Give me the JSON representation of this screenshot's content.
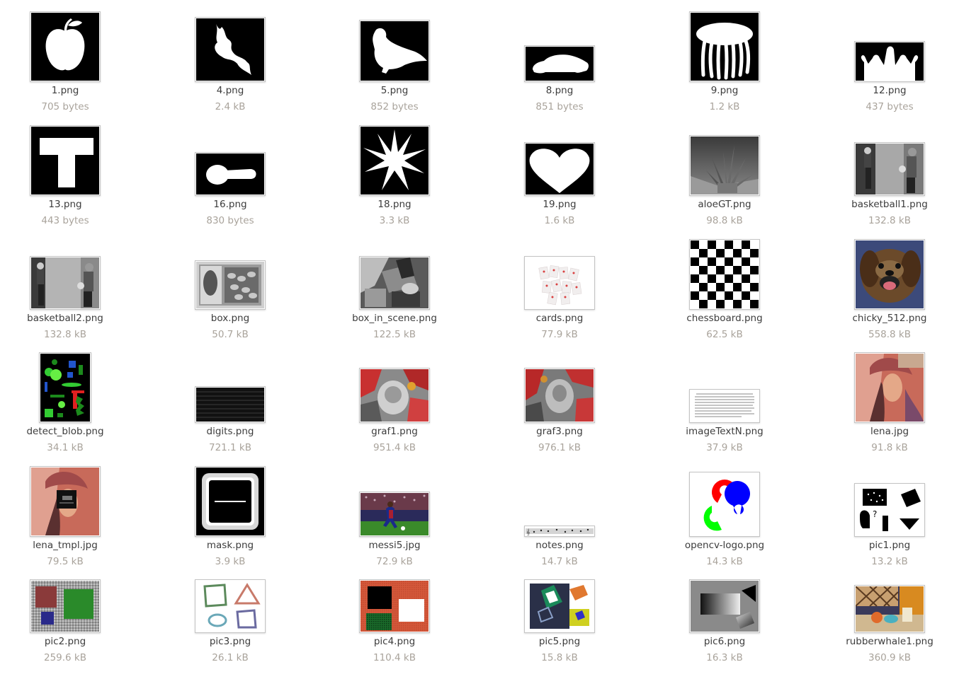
{
  "files": [
    {
      "name": "1.png",
      "size": "705 bytes",
      "icon": "apple-silhouette"
    },
    {
      "name": "4.png",
      "size": "2.4 kB",
      "icon": "bat-silhouette"
    },
    {
      "name": "5.png",
      "size": "852 bytes",
      "icon": "bird-silhouette"
    },
    {
      "name": "8.png",
      "size": "851 bytes",
      "icon": "car-silhouette"
    },
    {
      "name": "9.png",
      "size": "1.2 kB",
      "icon": "jellyfish-silhouette"
    },
    {
      "name": "12.png",
      "size": "437 bytes",
      "icon": "crown-silhouette"
    },
    {
      "name": "13.png",
      "size": "443 bytes",
      "icon": "t-shape"
    },
    {
      "name": "16.png",
      "size": "830 bytes",
      "icon": "key-silhouette"
    },
    {
      "name": "18.png",
      "size": "3.3 kB",
      "icon": "star-burst"
    },
    {
      "name": "19.png",
      "size": "1.6 kB",
      "icon": "heart-silhouette"
    },
    {
      "name": "aloeGT.png",
      "size": "98.8 kB",
      "icon": "aloe-depth"
    },
    {
      "name": "basketball1.png",
      "size": "132.8 kB",
      "icon": "basketball-photo"
    },
    {
      "name": "basketball2.png",
      "size": "132.8 kB",
      "icon": "basketball-photo"
    },
    {
      "name": "box.png",
      "size": "50.7 kB",
      "icon": "box-photo"
    },
    {
      "name": "box_in_scene.png",
      "size": "122.5 kB",
      "icon": "scene-photo"
    },
    {
      "name": "cards.png",
      "size": "77.9 kB",
      "icon": "cards-photo"
    },
    {
      "name": "chessboard.png",
      "size": "62.5 kB",
      "icon": "chessboard"
    },
    {
      "name": "chicky_512.png",
      "size": "558.8 kB",
      "icon": "dog-photo"
    },
    {
      "name": "detect_blob.png",
      "size": "34.1 kB",
      "icon": "blobs"
    },
    {
      "name": "digits.png",
      "size": "721.1 kB",
      "icon": "digits-strip"
    },
    {
      "name": "graf1.png",
      "size": "951.4 kB",
      "icon": "graffiti"
    },
    {
      "name": "graf3.png",
      "size": "976.1 kB",
      "icon": "graffiti"
    },
    {
      "name": "imageTextN.png",
      "size": "37.9 kB",
      "icon": "text-document"
    },
    {
      "name": "lena.jpg",
      "size": "91.8 kB",
      "icon": "portrait-photo"
    },
    {
      "name": "lena_tmpl.jpg",
      "size": "79.5 kB",
      "icon": "portrait-template"
    },
    {
      "name": "mask.png",
      "size": "3.9 kB",
      "icon": "mask-frame"
    },
    {
      "name": "messi5.jpg",
      "size": "72.9 kB",
      "icon": "soccer-photo"
    },
    {
      "name": "notes.png",
      "size": "14.7 kB",
      "icon": "music-notes"
    },
    {
      "name": "opencv-logo.png",
      "size": "14.3 kB",
      "icon": "opencv-logo"
    },
    {
      "name": "pic1.png",
      "size": "13.2 kB",
      "icon": "shapes-black"
    },
    {
      "name": "pic2.png",
      "size": "259.6 kB",
      "icon": "noisy-squares"
    },
    {
      "name": "pic3.png",
      "size": "26.1 kB",
      "icon": "outline-shapes"
    },
    {
      "name": "pic4.png",
      "size": "110.4 kB",
      "icon": "textured-squares"
    },
    {
      "name": "pic5.png",
      "size": "15.8 kB",
      "icon": "colored-shapes"
    },
    {
      "name": "pic6.png",
      "size": "16.3 kB",
      "icon": "gradient-shapes"
    },
    {
      "name": "rubberwhale1.png",
      "size": "360.9 kB",
      "icon": "rubberwhale-photo"
    }
  ],
  "colors": {
    "filename": "#3c3c3c",
    "filesize": "#a9a39b",
    "background": "#ffffff"
  }
}
